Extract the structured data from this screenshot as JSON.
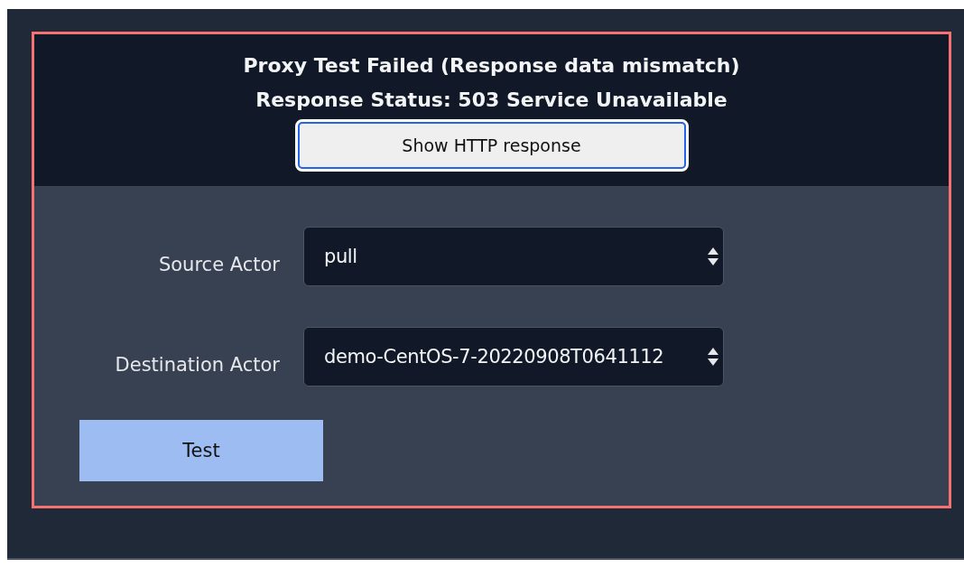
{
  "result": {
    "title": "Proxy Test Failed (Response data mismatch)",
    "status": "Response Status: 503 Service Unavailable",
    "button": "Show HTTP response"
  },
  "fields": [
    {
      "label": "Source Actor",
      "value": "pull"
    },
    {
      "label": "Destination Actor",
      "value": "demo-CentOS-7-20220908T0641112"
    }
  ],
  "test_button": "Test"
}
